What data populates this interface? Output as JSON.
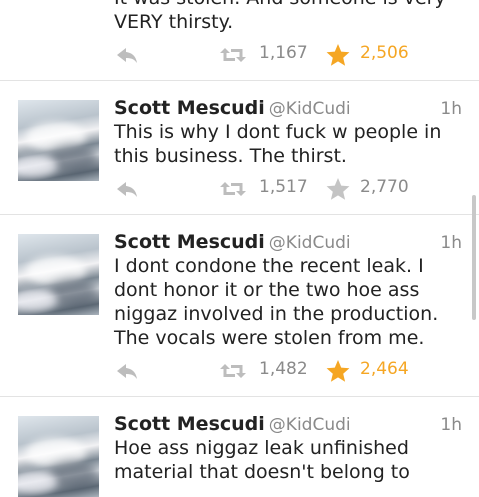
{
  "tweets": [
    {
      "text": "It was stolen.  And someone is very\nVERY thirsty.",
      "retweets": "1,167",
      "favorites": "2,506",
      "favorited": true
    },
    {
      "name": "Scott Mescudi",
      "handle": "@KidCudi",
      "time": "1h",
      "text": "This is why I dont fuck w people in\nthis business.  The thirst.",
      "retweets": "1,517",
      "favorites": "2,770",
      "favorited": false
    },
    {
      "name": "Scott Mescudi",
      "handle": "@KidCudi",
      "time": "1h",
      "text": "I dont condone the recent leak. I\ndont honor it or the two hoe ass\nniggaz involved in the production.\nThe vocals were stolen from me.",
      "retweets": "1,482",
      "favorites": "2,464",
      "favorited": true
    },
    {
      "name": "Scott Mescudi",
      "handle": "@KidCudi",
      "time": "1h",
      "text": "Hoe ass niggaz leak unfinished\nmaterial that doesn't belong to"
    }
  ],
  "colors": {
    "fav_active": "#f5a623",
    "muted": "#8a8a8a"
  },
  "icons": {
    "reply": "reply-arrow-icon",
    "retweet": "retweet-icon",
    "favorite": "star-icon"
  }
}
